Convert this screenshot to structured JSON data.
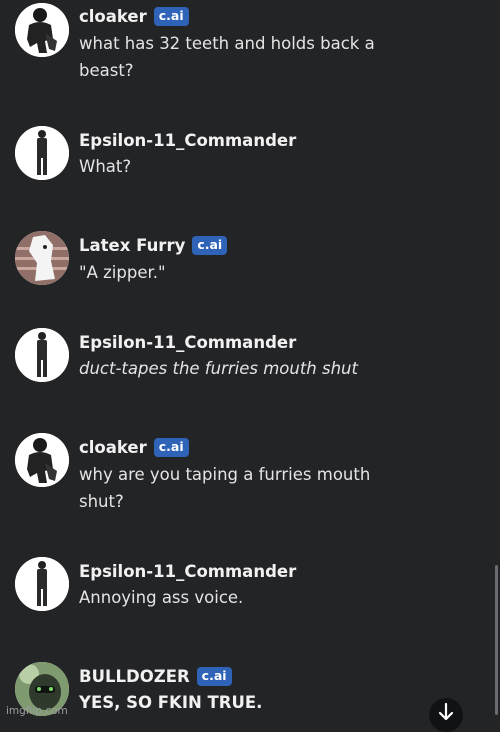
{
  "messages": [
    {
      "author": "cloaker",
      "badge": "c.ai",
      "lines": [
        "what has 32 teeth and holds back a",
        "beast?"
      ]
    },
    {
      "author": "Epsilon-11_Commander",
      "lines": [
        "What?"
      ]
    },
    {
      "author": "Latex Furry",
      "badge": "c.ai",
      "lines": [
        "\"A zipper.\""
      ]
    },
    {
      "author": "Epsilon-11_Commander",
      "lines": [
        "duct-tapes the furries mouth shut"
      ]
    },
    {
      "author": "cloaker",
      "badge": "c.ai",
      "lines": [
        "why are you taping a furries mouth",
        "shut?"
      ]
    },
    {
      "author": "Epsilon-11_Commander",
      "lines": [
        "Annoying ass voice."
      ]
    },
    {
      "author": "BULLDOZER",
      "badge": "c.ai",
      "lines": [
        "YES, SO FKIN TRUE."
      ]
    }
  ],
  "icons": {
    "scroll_down": "arrow-down-icon"
  },
  "watermark": "imgflip.com",
  "colors": {
    "background": "#232426",
    "badge": "#2f63b8",
    "text": "#e4e4e5"
  }
}
